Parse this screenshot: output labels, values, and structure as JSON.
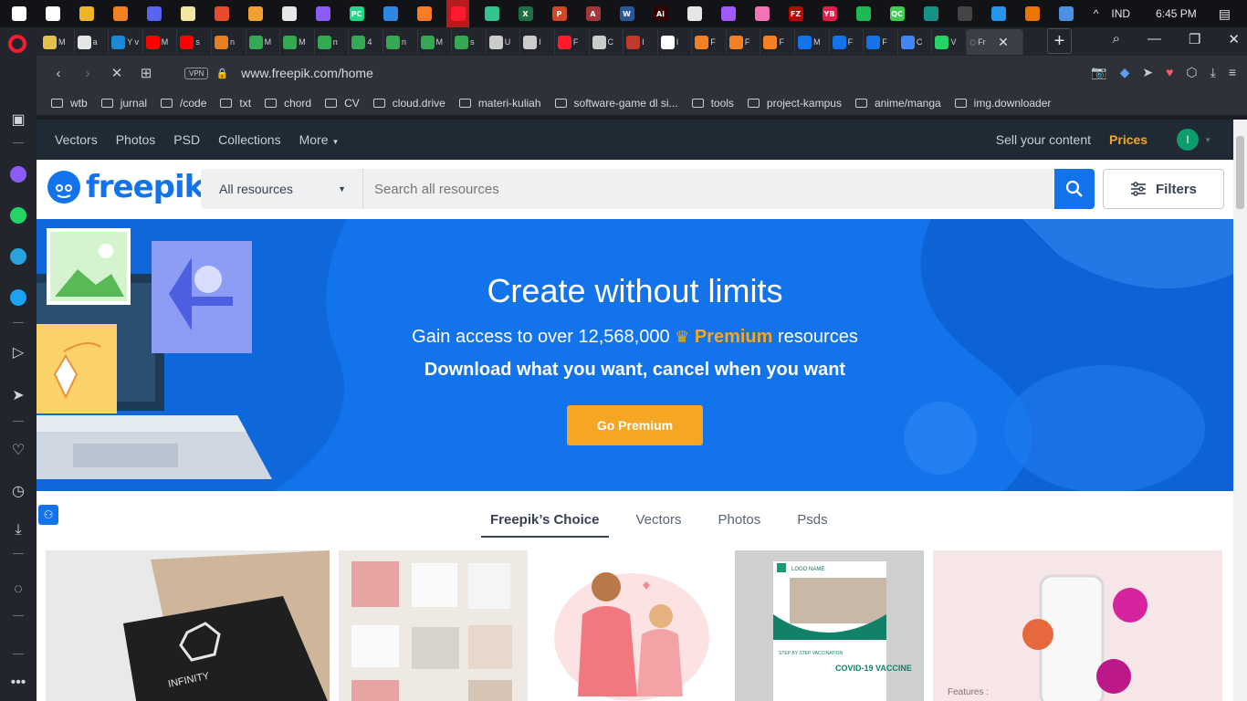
{
  "taskbar": {
    "apps": [
      {
        "icon": "windows-start-icon",
        "color": "#ffffff",
        "glyph": ""
      },
      {
        "icon": "settings-gear-icon",
        "color": "#ffffff",
        "glyph": ""
      },
      {
        "icon": "file-explorer-icon",
        "color": "#f0b429",
        "glyph": ""
      },
      {
        "icon": "vlc-icon",
        "color": "#f48120",
        "glyph": ""
      },
      {
        "icon": "discord-icon",
        "color": "#5865f2",
        "glyph": ""
      },
      {
        "icon": "notepad-icon",
        "color": "#f3e6a0",
        "glyph": ""
      },
      {
        "icon": "paint-icon",
        "color": "#e84a2c",
        "glyph": ""
      },
      {
        "icon": "hammer-icon",
        "color": "#f0a030",
        "glyph": ""
      },
      {
        "icon": "gamepad-icon",
        "color": "#e6e6e6",
        "glyph": ""
      },
      {
        "icon": "github-icon",
        "color": "#8b5cf6",
        "glyph": ""
      },
      {
        "icon": "pycharm-icon",
        "color": "#21d789",
        "glyph": "PC"
      },
      {
        "icon": "vscode-icon",
        "color": "#2f88e0",
        "glyph": ""
      },
      {
        "icon": "xampp-icon",
        "color": "#fb7a24",
        "glyph": ""
      },
      {
        "icon": "opera-icon",
        "color": "#ff1b2d",
        "glyph": ""
      },
      {
        "icon": "edge-icon",
        "color": "#34c38f",
        "glyph": ""
      },
      {
        "icon": "excel-icon",
        "color": "#1d7044",
        "glyph": "X"
      },
      {
        "icon": "powerpoint-icon",
        "color": "#d24726",
        "glyph": "P"
      },
      {
        "icon": "access-icon",
        "color": "#a4373a",
        "glyph": "A"
      },
      {
        "icon": "word-icon",
        "color": "#2b579a",
        "glyph": "W"
      },
      {
        "icon": "illustrator-icon",
        "color": "#330000",
        "glyph": "Ai"
      },
      {
        "icon": "document-icon",
        "color": "#e6e6e6",
        "glyph": ""
      },
      {
        "icon": "figma-icon",
        "color": "#a259ff",
        "glyph": ""
      },
      {
        "icon": "anime-icon",
        "color": "#f472b6",
        "glyph": ""
      },
      {
        "icon": "filezilla-icon",
        "color": "#bf0000",
        "glyph": "FZ"
      },
      {
        "icon": "yb-icon",
        "color": "#e11d48",
        "glyph": "YB"
      },
      {
        "icon": "spotify-icon",
        "color": "#1db954",
        "glyph": ""
      },
      {
        "icon": "qtcreator-icon",
        "color": "#41cd52",
        "glyph": "QC"
      },
      {
        "icon": "gitkraken-icon",
        "color": "#179287",
        "glyph": ""
      },
      {
        "icon": "obs-icon",
        "color": "#444444",
        "glyph": ""
      },
      {
        "icon": "docker-icon",
        "color": "#2496ed",
        "glyph": ""
      },
      {
        "icon": "blender-icon",
        "color": "#ea7600",
        "glyph": ""
      },
      {
        "icon": "photos-icon",
        "color": "#4a90e2",
        "glyph": ""
      }
    ],
    "tray": {
      "chevron": "^",
      "language": "IND",
      "time": "6:45 PM"
    }
  },
  "tabs": {
    "items": [
      {
        "icon": "tab-favicon",
        "color": "#e6c14a",
        "title": "M"
      },
      {
        "icon": "tab-favicon",
        "color": "#e6e6e6",
        "title": "a"
      },
      {
        "icon": "tab-favicon",
        "color": "#1a8ad6",
        "title": "Y v"
      },
      {
        "icon": "youtube-favicon",
        "color": "#ff0000",
        "title": "M"
      },
      {
        "icon": "youtube-favicon",
        "color": "#ff0000",
        "title": "s"
      },
      {
        "icon": "tab-favicon",
        "color": "#e67e22",
        "title": "n"
      },
      {
        "icon": "drive-favicon",
        "color": "#34a853",
        "title": "M"
      },
      {
        "icon": "drive-favicon",
        "color": "#34a853",
        "title": "M"
      },
      {
        "icon": "drive-favicon",
        "color": "#34a853",
        "title": "n"
      },
      {
        "icon": "drive-favicon",
        "color": "#34a853",
        "title": "4"
      },
      {
        "icon": "drive-favicon",
        "color": "#34a853",
        "title": "n"
      },
      {
        "icon": "drive-favicon",
        "color": "#34a853",
        "title": "M"
      },
      {
        "icon": "drive-favicon",
        "color": "#34a853",
        "title": "s"
      },
      {
        "icon": "tab-favicon",
        "color": "#cccccc",
        "title": "U"
      },
      {
        "icon": "tab-favicon",
        "color": "#cccccc",
        "title": "I"
      },
      {
        "icon": "tab-favicon",
        "color": "#ff1b2d",
        "title": "F"
      },
      {
        "icon": "tab-favicon",
        "color": "#cccccc",
        "title": "C"
      },
      {
        "icon": "tab-favicon",
        "color": "#c0392b",
        "title": "I"
      },
      {
        "icon": "google-favicon",
        "color": "#ffffff",
        "title": "I"
      },
      {
        "icon": "stackoverflow-favicon",
        "color": "#f48024",
        "title": "F"
      },
      {
        "icon": "stackoverflow-favicon",
        "color": "#f48024",
        "title": "F"
      },
      {
        "icon": "stackoverflow-favicon",
        "color": "#f48024",
        "title": "F"
      },
      {
        "icon": "freepik-favicon",
        "color": "#1273eb",
        "title": "M"
      },
      {
        "icon": "freepik-favicon",
        "color": "#1273eb",
        "title": "F"
      },
      {
        "icon": "freepik-favicon",
        "color": "#1273eb",
        "title": "F"
      },
      {
        "icon": "translate-favicon",
        "color": "#4285f4",
        "title": "C"
      },
      {
        "icon": "whatsapp-favicon",
        "color": "#25d366",
        "title": "V"
      }
    ],
    "active": {
      "icon": "loading-spinner-icon",
      "title": "Fr",
      "close": "✕"
    },
    "new_tab": "+",
    "controls": {
      "search": "⌕",
      "restore": "❐",
      "close": "✕"
    }
  },
  "address": {
    "back": "‹",
    "forward": "›",
    "stop": "✕",
    "grid": "⊞",
    "vpn": "VPN",
    "url": "www.freepik.com/home",
    "right_icons": [
      "📷",
      "◆",
      "➤",
      "♥",
      "⬡",
      "⤓",
      "≡"
    ]
  },
  "bookmarks": [
    "wtb",
    "jurnal",
    "/code",
    "txt",
    "chord",
    "CV",
    "cloud.drive",
    "materi-kuliah",
    "software-game dl si...",
    "tools",
    "project-kampus",
    "anime/manga",
    "img.downloader"
  ],
  "sidebar": {
    "items": [
      {
        "icon": "workspaces-icon",
        "glyph": "▣",
        "color": "#d2d5db"
      },
      {
        "icon": "messenger-icon",
        "glyph": "",
        "color": "#8b5cf6"
      },
      {
        "icon": "whatsapp-icon",
        "glyph": "",
        "color": "#25d366"
      },
      {
        "icon": "telegram-icon",
        "glyph": "",
        "color": "#2aa3df"
      },
      {
        "icon": "twitter-icon",
        "glyph": "",
        "color": "#1da1f2"
      },
      {
        "icon": "player-icon",
        "glyph": "▷",
        "color": "#d2d5db"
      },
      {
        "icon": "send-icon",
        "glyph": "➤",
        "color": "#d2d5db"
      },
      {
        "icon": "favorites-icon",
        "glyph": "♡",
        "color": "#d2d5db"
      },
      {
        "icon": "history-icon",
        "glyph": "◷",
        "color": "#d2d5db"
      },
      {
        "icon": "downloads-icon",
        "glyph": "⤓",
        "color": "#d2d5db"
      },
      {
        "icon": "lightbulb-icon",
        "glyph": "◌",
        "color": "#d2d5db"
      },
      {
        "icon": "more-icon",
        "glyph": "•••",
        "color": "#d2d5db"
      }
    ]
  },
  "freepik": {
    "nav": [
      "Vectors",
      "Photos",
      "PSD",
      "Collections",
      "More"
    ],
    "sell": "Sell your content",
    "prices": "Prices",
    "avatar": "I",
    "logo": "freepik",
    "resource_select": "All resources",
    "search_placeholder": "Search all resources",
    "filters": "Filters",
    "brand_color": "#1273eb",
    "accent_color": "#f5a623",
    "hero": {
      "title": "Create without limits",
      "sub_prefix": "Gain access to over 12,568,000",
      "premium": "Premium",
      "sub_suffix": "resources",
      "strong": "Download what you want, cancel when you want",
      "cta": "Go Premium"
    },
    "content_tabs": [
      "Freepik’s Choice",
      "Vectors",
      "Photos",
      "Psds"
    ],
    "thumbs": [
      {
        "kind": "infinity-logo-mockup",
        "caption": "INFINITY"
      },
      {
        "kind": "paper-notes-collection",
        "caption": ""
      },
      {
        "kind": "mother-daughter-illustration",
        "caption": ""
      },
      {
        "kind": "vaccine-flyer",
        "caption": "COVID-19 VACCINE",
        "logo": "LOGO NAME",
        "heading": "STEP BY STEP VACCINATION"
      },
      {
        "kind": "instagram-phone-mockup",
        "caption": "Features :"
      }
    ]
  }
}
